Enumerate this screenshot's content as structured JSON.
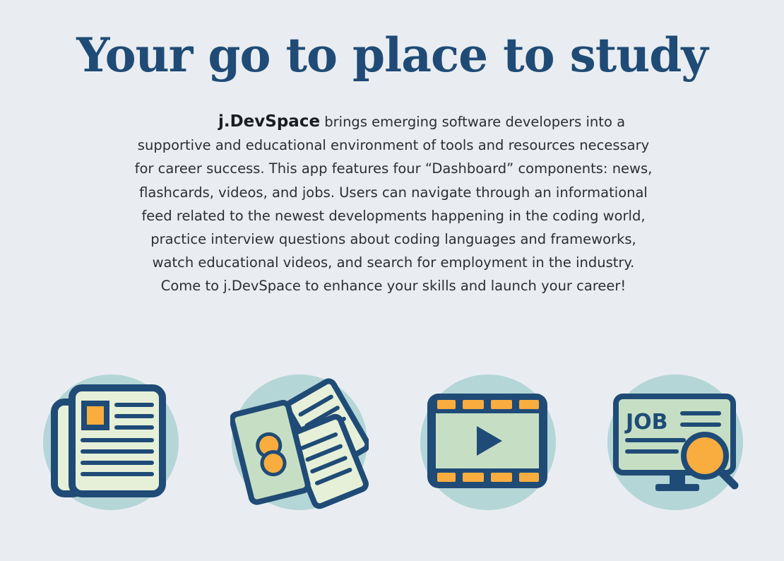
{
  "hero": {
    "title": "Your go to place to study",
    "brand": "j.DevSpace",
    "description": "brings emerging software developers into a supportive and educational environment of tools and resources necessary for career success. This app features four “Dashboard” components: news, flashcards, videos, and jobs. Users can navigate through an informational feed related to the newest developments happening in the coding world, practice interview questions about coding languages and frameworks, watch educational videos, and search for employment in the industry. Come to j.DevSpace to enhance your skills and launch your career!"
  },
  "features": [
    {
      "icon": "newspaper-icon"
    },
    {
      "icon": "flashcards-icon"
    },
    {
      "icon": "video-player-icon"
    },
    {
      "icon": "job-search-icon",
      "label": "JOB"
    }
  ],
  "colors": {
    "background": "#e9edf1",
    "navy": "#1f4b76",
    "circle": "#b5d6d7",
    "card_fill": "#e6f0d8",
    "mint": "#c6dfc4",
    "orange": "#f9ad3e"
  }
}
